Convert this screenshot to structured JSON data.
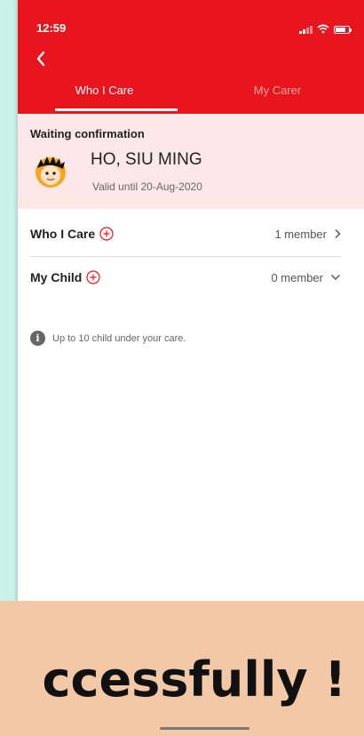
{
  "status_bar": {
    "time": "12:59"
  },
  "tabs": [
    {
      "label": "Who I Care",
      "active": true
    },
    {
      "label": "My Carer",
      "active": false
    }
  ],
  "waiting": {
    "title": "Waiting confirmation",
    "name": "HO, SIU MING",
    "valid_until": "Valid until 20-Aug-2020"
  },
  "rows": [
    {
      "label": "Who I Care",
      "count": "1 member",
      "chevron": "chevron-right-icon"
    },
    {
      "label": "My Child",
      "count": "0 member",
      "chevron": "chevron-down-icon"
    }
  ],
  "info_note": "Up to 10 child under your care.",
  "banner": {
    "text": "ccessfully !"
  },
  "colors": {
    "accent": "#e8141e",
    "waiting_bg": "#fde8e7",
    "banner_bg": "#f2c8a6",
    "page_bg": "#c9f3ea"
  }
}
